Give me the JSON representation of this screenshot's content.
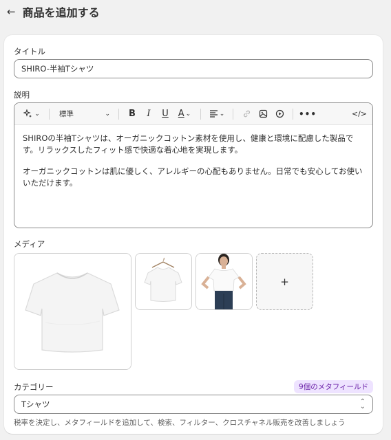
{
  "header": {
    "title": "商品を追加する",
    "back_icon": "arrow-left-icon"
  },
  "title_field": {
    "label": "タイトル",
    "value": "SHIRO-半袖Tシャツ"
  },
  "description": {
    "label": "説明",
    "toolbar": {
      "style_select": "標準",
      "icons": [
        "magic-icon",
        "bold-icon",
        "italic-icon",
        "underline-icon",
        "text-color-icon",
        "align-icon",
        "link-icon",
        "image-icon",
        "video-icon",
        "more-icon",
        "code-icon"
      ]
    },
    "paragraphs": [
      "SHIROの半袖Tシャツは、オーガニックコットン素材を使用し、健康と環境に配慮した製品です。リラックスしたフィット感で快適な着心地を実現します。",
      "オーガニックコットンは肌に優しく、アレルギーの心配もありません。日常でも安心してお使いいただけます。"
    ]
  },
  "media": {
    "label": "メディア",
    "add_label": "+"
  },
  "category": {
    "label": "カテゴリー",
    "badge": "9個のメタフィールド",
    "value": "Tシャツ",
    "help": "税率を決定し、メタフィールドを追加して、検索、フィルター、クロスチャネル販売を改善しましょう"
  },
  "colors": {
    "badge_bg": "#eee3ff",
    "badge_text": "#6b21a8",
    "page_bg": "#f1f1f1"
  }
}
